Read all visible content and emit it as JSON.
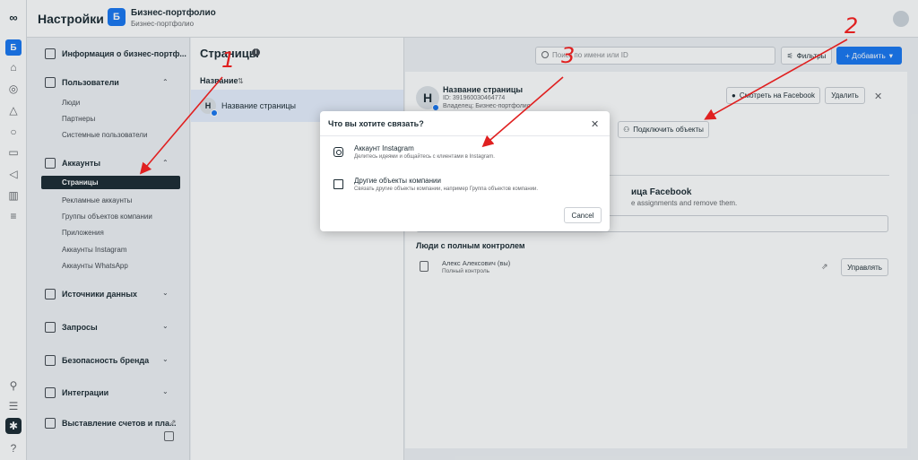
{
  "rail": {
    "logo": "meta-icon",
    "badge_letter": "Б",
    "icons": [
      "home-icon",
      "target-icon",
      "bell-icon",
      "chat-icon",
      "inbox-icon",
      "megaphone-icon",
      "chart-icon",
      "menu-icon",
      "search-icon",
      "list-icon",
      "gear-icon",
      "help-icon"
    ]
  },
  "header": {
    "title": "Настройки",
    "portfolio_letter": "Б",
    "portfolio_name": "Бизнес-портфолио",
    "portfolio_sub": "Бизнес-портфолио"
  },
  "sidebar": {
    "info": "Информация о бизнес-портф...",
    "users_section": "Пользователи",
    "users_items": [
      "Люди",
      "Партнеры",
      "Системные пользователи"
    ],
    "accounts_section": "Аккаунты",
    "accounts_items": [
      "Страницы",
      "Рекламные аккаунты",
      "Группы объектов компании",
      "Приложения",
      "Аккаунты Instagram",
      "Аккаунты WhatsApp"
    ],
    "data_sources": "Источники данных",
    "requests": "Запросы",
    "brand_safety": "Безопасность бренда",
    "integrations": "Интеграции",
    "billing": "Выставление счетов и пла..."
  },
  "list": {
    "title": "Страницы",
    "column": "Название",
    "row_letter": "Н",
    "row_label": "Название страницы"
  },
  "toolbar": {
    "search_placeholder": "Поиск по имени или ID",
    "filters": "Фильтры",
    "add": "+ Добавить"
  },
  "detail": {
    "letter": "Н",
    "name": "Название страницы",
    "id_line": "ID: 391960030464774",
    "owner_line": "Владелец: Бизнес-портфолио",
    "view_fb": "Смотреть на Facebook",
    "delete": "Удалить",
    "connect": "Подключить объекты",
    "heading_fragment": "ица Facebook",
    "sub_fragment": "e assignments and remove them.",
    "people_heading": "Люди с полным контролем",
    "person_name": "Алекс Алексович (вы)",
    "person_role": "Полный контроль",
    "manage": "Управлять"
  },
  "modal": {
    "title": "Что вы хотите связать?",
    "option1_title": "Аккаунт Instagram",
    "option1_desc": "Делитесь идеями и общайтесь с клиентами в Instagram.",
    "option2_title": "Другие объекты компании",
    "option2_desc": "Связать другие объекты компании, например Группа объектов компании.",
    "cancel": "Cancel"
  },
  "annotations": {
    "color": "#e02020",
    "labels": [
      "1",
      "2",
      "3"
    ]
  }
}
